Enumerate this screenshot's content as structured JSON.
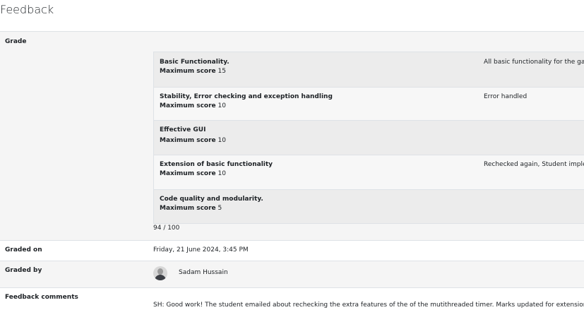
{
  "page": {
    "title": "Feedback"
  },
  "grade": {
    "label": "Grade",
    "max_label": "Maximum score",
    "criteria": [
      {
        "name": "Basic Functionality.",
        "max": "15",
        "remark": "All basic functionality for the game"
      },
      {
        "name": "Stability, Error checking and exception handling",
        "max": "10",
        "remark": "Error handled"
      },
      {
        "name": "Effective GUI",
        "max": "10",
        "remark": ""
      },
      {
        "name": "Extension of basic functionality",
        "max": "10",
        "remark": "Rechecked again, Student implemen"
      },
      {
        "name": "Code quality and modularity.",
        "max": "5",
        "remark": ""
      }
    ],
    "total": "94 / 100"
  },
  "graded_on": {
    "label": "Graded on",
    "value": "Friday, 21 June 2024, 3:45 PM"
  },
  "graded_by": {
    "label": "Graded by",
    "name": "Sadam Hussain"
  },
  "comments": {
    "label": "Feedback comments",
    "value": "SH: Good work! The student emailed about rechecking the extra features of the of the mutithreaded timer. Marks updated for extension."
  }
}
